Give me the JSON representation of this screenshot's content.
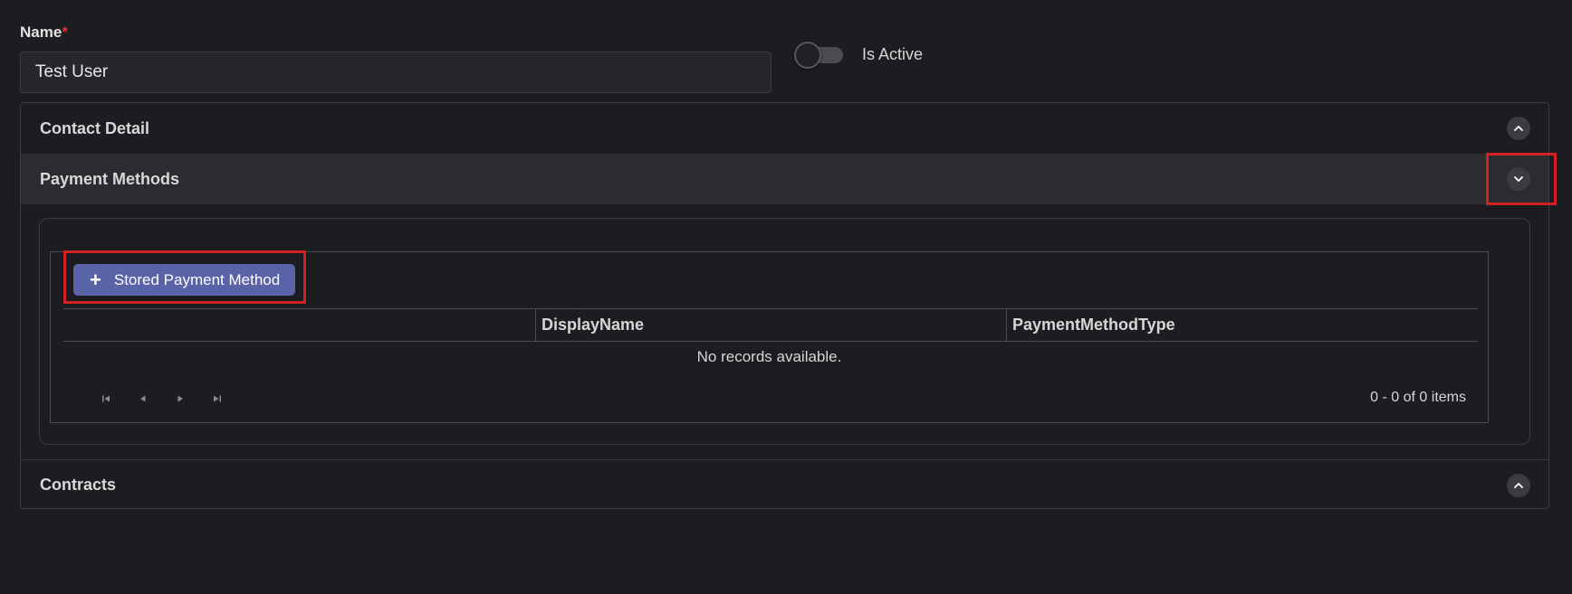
{
  "form": {
    "name_label": "Name",
    "required_marker": "*",
    "name_value": "Test User",
    "is_active_label": "Is Active",
    "is_active": false
  },
  "accordion": {
    "contact_detail": "Contact Detail",
    "payment_methods": "Payment Methods",
    "contracts": "Contracts"
  },
  "payment_grid": {
    "add_button_label": "Stored Payment Method",
    "columns": [
      "",
      "DisplayName",
      "PaymentMethodType"
    ],
    "empty_message": "No records available.",
    "items_info": "0 - 0 of 0 items",
    "pager_icons": [
      "first-page-icon",
      "prev-page-icon",
      "next-page-icon",
      "last-page-icon"
    ]
  },
  "colors": {
    "background": "#1c1d20",
    "accent_button": "#5a63a8",
    "highlight": "#d42027",
    "required": "#e0303c"
  }
}
